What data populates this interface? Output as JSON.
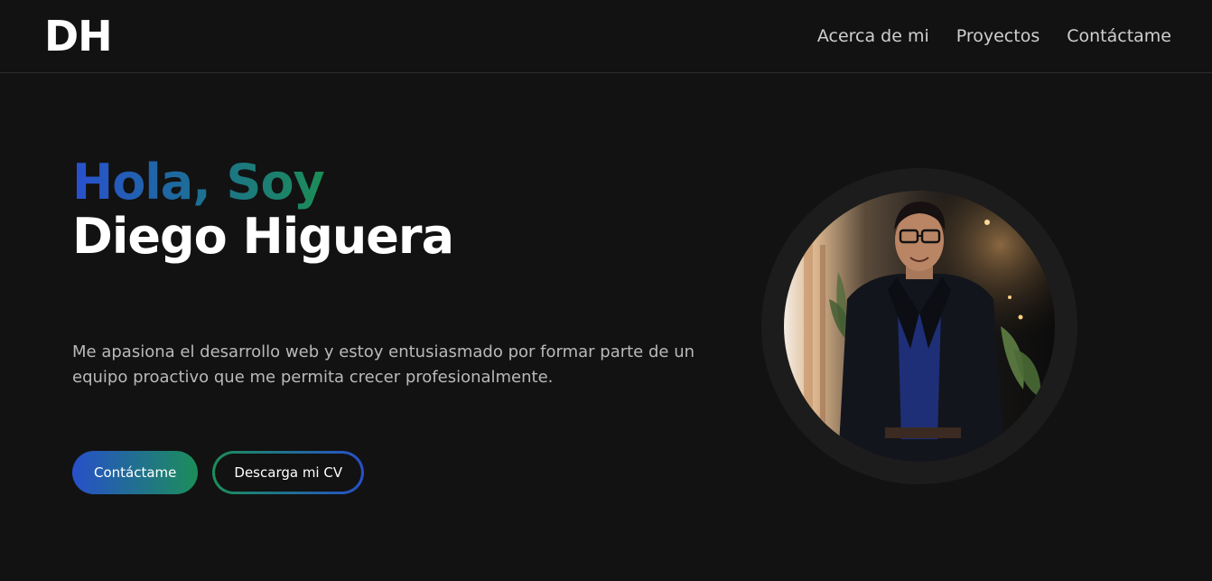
{
  "header": {
    "logo": "DH",
    "nav": {
      "about": "Acerca de mi",
      "projects": "Proyectos",
      "contact": "Contáctame"
    }
  },
  "hero": {
    "greeting": "Hola, Soy",
    "name": "Diego Higuera",
    "intro": "Me apasiona el desarrollo web y estoy entusiasmado por formar parte de un equipo proactivo que me permita crecer profesionalmente.",
    "contact_button": "Contáctame",
    "cv_button": "Descarga mi CV"
  },
  "colors": {
    "background": "#121212",
    "accent_blue": "#2750c9",
    "accent_green": "#1c8e5a"
  }
}
